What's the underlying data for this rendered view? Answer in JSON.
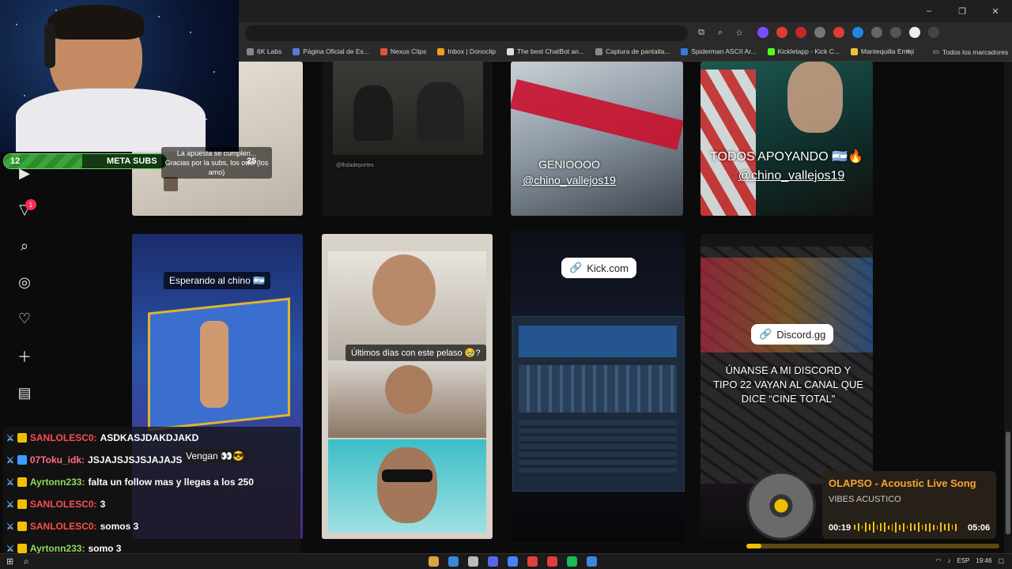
{
  "browser": {
    "controls": {
      "minimize": "–",
      "restore": "❐",
      "close": "✕"
    },
    "bookmarks": [
      {
        "label": "6K Labs",
        "color": "#888888"
      },
      {
        "label": "Página Oficial de Es...",
        "color": "#5a7bd4"
      },
      {
        "label": "Nexus Clips",
        "color": "#e0533d"
      },
      {
        "label": "Inbox | Donoclip",
        "color": "#f0a020"
      },
      {
        "label": "The best ChatBot an...",
        "color": "#dddddd"
      },
      {
        "label": "Captura de pantalla...",
        "color": "#8a8a8a"
      },
      {
        "label": "Spiderman ASCII Ar...",
        "color": "#3a7bd5"
      },
      {
        "label": "Kickletapp - Kick C...",
        "color": "#53fc18"
      },
      {
        "label": "Mantequilla Emoji",
        "color": "#f0c040"
      }
    ],
    "bookmarks_more": "»",
    "bookmarks_all": "Todos los marcadores"
  },
  "feed": {
    "tile2_credit": "@lhdadeportes",
    "tile3_text_line1": "GENIOOOO",
    "tile3_text_line2": "@chino_vallejos19",
    "tile4_text_line1": "TODOS APOYANDO 🇦🇷🔥",
    "tile4_text_line2": "@chino_vallejos19",
    "tile5_text": "Esperando al chino 🇦🇷",
    "tile6_text": "Últimos días  con este pelaso 🥹?",
    "tile7_link": "Kick.com",
    "tile8_link": "Discord.gg",
    "tile8_text": "ÚNANSE A MI DISCORD Y TIPO 22 VAYAN AL CANAL QUE DICE “CINE TOTAL”"
  },
  "nav": {
    "notification_count": "1"
  },
  "stream": {
    "subs_count": "12",
    "subs_label": "META SUBS",
    "subs_goal_text": "La apuesta se cumplen... Gracias por la subs, los odio (los amo)",
    "subs_target": "25",
    "subs_progress": 0.48
  },
  "chat": [
    {
      "user": "SANLOLESC0:",
      "user_color": "#ff4d4d",
      "badge": "#f0c000",
      "message": "ASDKASJDAKDJAKD"
    },
    {
      "user": "07Toku_idk:",
      "user_color": "#ff6b8a",
      "badge": "#3aa0ff",
      "message": "JSJAJSJSJSJAJAJS"
    },
    {
      "user": "Ayrtonn233:",
      "user_color": "#8fdc5a",
      "badge": "#f0c000",
      "message": "falta un follow mas y llegas a los 250"
    },
    {
      "user": "SANLOLESC0:",
      "user_color": "#ff4d4d",
      "badge": "#f0c000",
      "message": "3"
    },
    {
      "user": "SANLOLESC0:",
      "user_color": "#ff4d4d",
      "badge": "#f0c000",
      "message": "somos 3"
    },
    {
      "user": "Ayrtonn233:",
      "user_color": "#8fdc5a",
      "badge": "#f0c000",
      "message": "somo 3"
    }
  ],
  "chat_side_text": "Vengan 👀😎",
  "music": {
    "title": "OLAPSO - Acoustic Live Song",
    "artist": "VIBES ACUSTICO",
    "elapsed": "00:19",
    "duration": "05:06",
    "progress": 0.06
  },
  "taskbar": {
    "icons": [
      "#d9a441",
      "#3b87e0",
      "#bbbbbb",
      "#5865f2",
      "#4285f4",
      "#e23e3e",
      "#e23e3e",
      "#1db954",
      "#3b87e0"
    ],
    "lang": "ESP",
    "time": "19:46"
  }
}
